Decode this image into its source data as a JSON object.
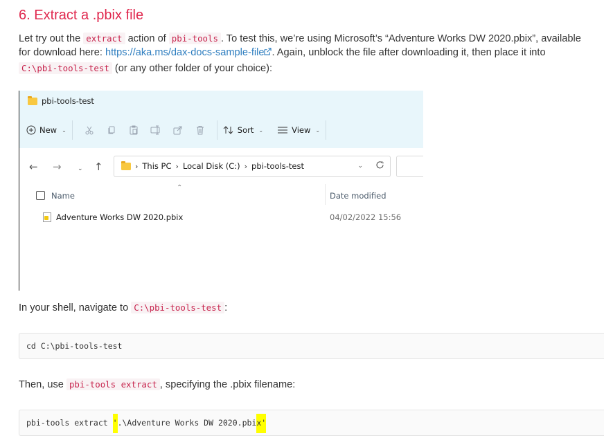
{
  "heading": "6. Extract a .pbix file",
  "intro": {
    "t1": "Let try out the ",
    "code1": "extract",
    "t2": " action of ",
    "code2": "pbi-tools",
    "t3": ". To test this, we’re using Microsoft’s “Adventure Works DW 2020.pbix”, available",
    "t4": "for download here: ",
    "link": "https://aka.ms/dax-docs-sample-file",
    "t5": ". Again, unblock the file after downloading it, then place it into",
    "code3": "C:\\pbi-tools-test",
    "t6": " (or any other folder of your choice):"
  },
  "explorer": {
    "window_title": "pbi-tools-test",
    "toolbar": {
      "new_label": "New",
      "sort_label": "Sort",
      "view_label": "View"
    },
    "breadcrumb": [
      "This PC",
      "Local Disk (C:)",
      "pbi-tools-test"
    ],
    "columns": {
      "name": "Name",
      "date_modified": "Date modified"
    },
    "files": [
      {
        "name": "Adventure Works DW 2020.pbix",
        "date": "04/02/2022 15:56"
      }
    ]
  },
  "shell": {
    "t1": "In your shell, navigate to ",
    "code": "C:\\pbi-tools-test",
    "t2": ":",
    "command": "cd C:\\pbi-tools-test"
  },
  "extract": {
    "t1": "Then, use ",
    "code": "pbi-tools extract",
    "t2": ", specifying the .pbix filename:",
    "cmd_part1": "pbi-tools extract ",
    "cmd_quote_open": "'",
    "cmd_part2": ".\\Adventure Works DW 2020.pbi",
    "cmd_quote_close": "x'"
  },
  "colors": {
    "heading": "#e0284e",
    "link": "#2d7dbf",
    "code_text": "#c7254e",
    "explorer_header_bg": "#e8f6fb",
    "highlight": "#ffff00"
  }
}
